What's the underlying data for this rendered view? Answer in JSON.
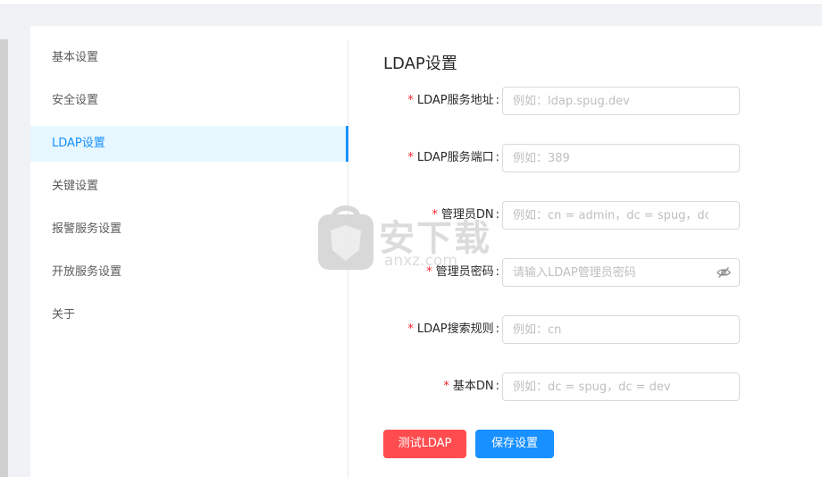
{
  "sidebar": {
    "items": [
      {
        "label": "基本设置"
      },
      {
        "label": "安全设置"
      },
      {
        "label": "LDAP设置"
      },
      {
        "label": "关键设置"
      },
      {
        "label": "报警服务设置"
      },
      {
        "label": "开放服务设置"
      },
      {
        "label": "关于"
      }
    ],
    "active_index": 2
  },
  "main": {
    "title": "LDAP设置",
    "required_mark": "*",
    "fields": [
      {
        "label": "LDAP服务地址",
        "placeholder": "例如：ldap.spug.dev",
        "value": ""
      },
      {
        "label": "LDAP服务端口",
        "placeholder": "例如：389",
        "value": ""
      },
      {
        "label": "管理员DN",
        "placeholder": "例如：cn = admin，dc = spug，dc =...",
        "value": ""
      },
      {
        "label": "管理员密码",
        "placeholder": "请输入LDAP管理员密码",
        "value": "",
        "icon": "eye-invisible-icon"
      },
      {
        "label": "LDAP搜索规则",
        "placeholder": "例如：cn",
        "value": ""
      },
      {
        "label": "基本DN",
        "placeholder": "例如：dc = spug，dc = dev",
        "value": ""
      }
    ],
    "colon": ":",
    "buttons": {
      "test_label": "测试LDAP",
      "save_label": "保存设置"
    }
  },
  "watermark": {
    "text": "安下载",
    "subtext": "anxz.com",
    "icon": "shield-bag-icon"
  },
  "colors": {
    "primary": "#1890ff",
    "danger": "#ff4d4f",
    "required": "#f5222d",
    "active_bg": "#e6f7ff"
  }
}
